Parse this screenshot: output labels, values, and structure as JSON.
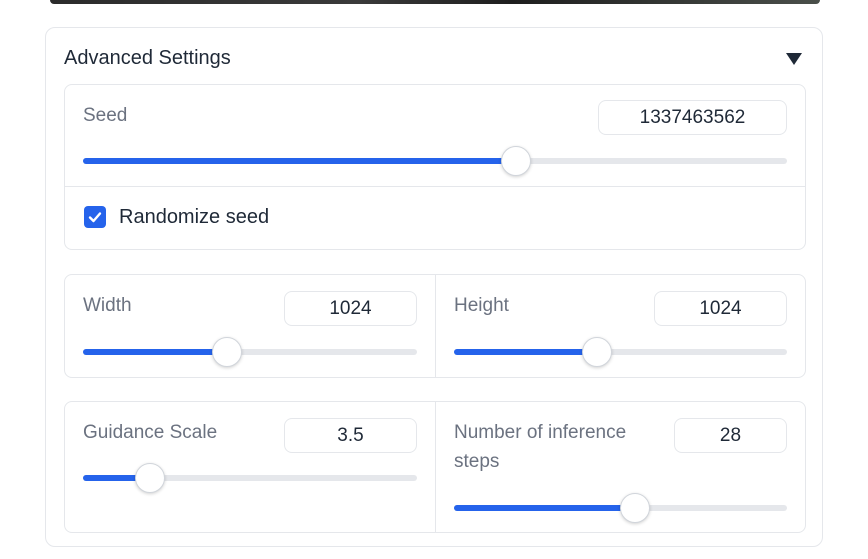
{
  "accent_color": "#2563eb",
  "advanced": {
    "title": "Advanced Settings",
    "toggle_icon": "triangle-down-icon"
  },
  "seed": {
    "label": "Seed",
    "value": "1337463562",
    "fraction": 0.615,
    "randomize": {
      "label": "Randomize seed",
      "checked": true
    }
  },
  "width": {
    "label": "Width",
    "value": "1024",
    "fraction": 0.43
  },
  "height": {
    "label": "Height",
    "value": "1024",
    "fraction": 0.43
  },
  "guidance": {
    "label": "Guidance Scale",
    "value": "3.5",
    "fraction": 0.2
  },
  "steps": {
    "label": "Number of inference\nsteps",
    "value": "28",
    "fraction": 0.545
  }
}
